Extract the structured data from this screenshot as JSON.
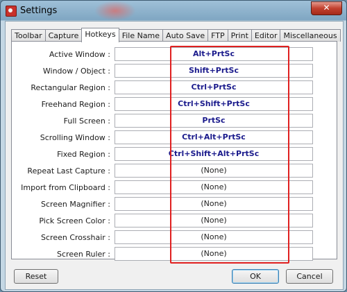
{
  "window": {
    "title": "Settings",
    "close_symbol": "✕"
  },
  "tabs": [
    {
      "label": "Toolbar"
    },
    {
      "label": "Capture"
    },
    {
      "label": "Hotkeys",
      "active": true
    },
    {
      "label": "File Name"
    },
    {
      "label": "Auto Save"
    },
    {
      "label": "FTP"
    },
    {
      "label": "Print"
    },
    {
      "label": "Editor"
    },
    {
      "label": "Miscellaneous"
    }
  ],
  "hotkeys": [
    {
      "label": "Active Window :",
      "value": "Alt+PrtSc",
      "set": true
    },
    {
      "label": "Window / Object :",
      "value": "Shift+PrtSc",
      "set": true
    },
    {
      "label": "Rectangular Region :",
      "value": "Ctrl+PrtSc",
      "set": true
    },
    {
      "label": "Freehand Region :",
      "value": "Ctrl+Shift+PrtSc",
      "set": true
    },
    {
      "label": "Full Screen :",
      "value": "PrtSc",
      "set": true
    },
    {
      "label": "Scrolling Window :",
      "value": "Ctrl+Alt+PrtSc",
      "set": true
    },
    {
      "label": "Fixed Region :",
      "value": "Ctrl+Shift+Alt+PrtSc",
      "set": true
    },
    {
      "label": "Repeat Last Capture :",
      "value": "(None)",
      "set": false
    },
    {
      "label": "Import from Clipboard :",
      "value": "(None)",
      "set": false
    },
    {
      "label": "Screen Magnifier :",
      "value": "(None)",
      "set": false
    },
    {
      "label": "Pick Screen Color :",
      "value": "(None)",
      "set": false
    },
    {
      "label": "Screen Crosshair :",
      "value": "(None)",
      "set": false
    },
    {
      "label": "Screen Ruler :",
      "value": "(None)",
      "set": false
    }
  ],
  "buttons": {
    "reset": "Reset",
    "ok": "OK",
    "cancel": "Cancel"
  },
  "colors": {
    "highlight": "#e02020",
    "set_hotkey_text": "#1a1a8c"
  }
}
